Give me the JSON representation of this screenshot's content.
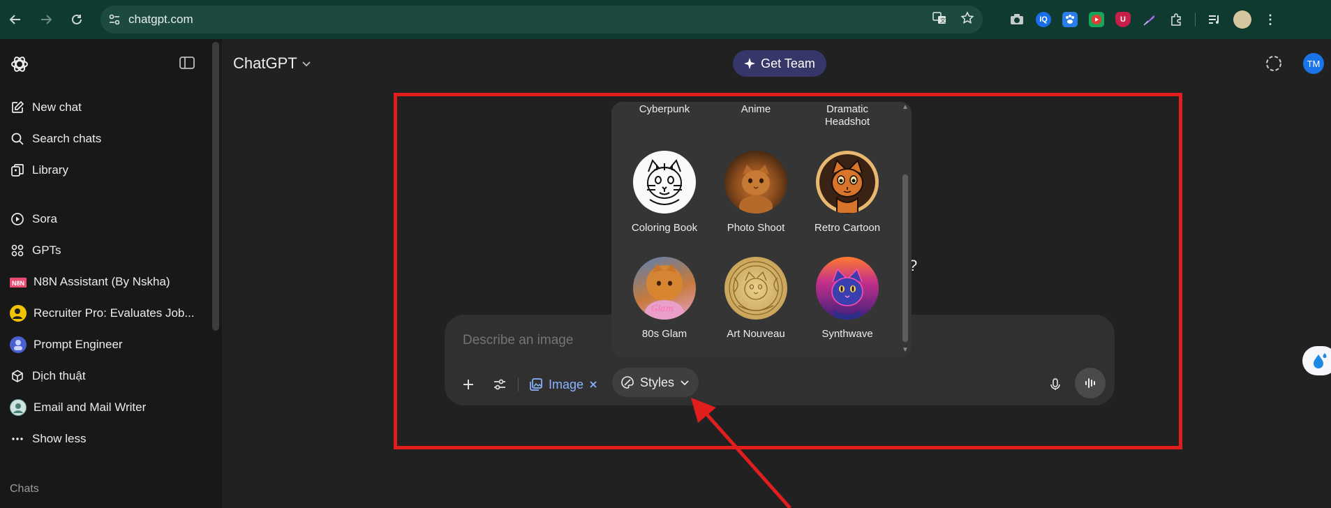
{
  "browser": {
    "url": "chatgpt.com",
    "back_icon": "arrow-left-icon",
    "forward_icon": "arrow-right-icon",
    "reload_icon": "reload-icon"
  },
  "sidebar": {
    "items": [
      {
        "label": "New chat",
        "icon": "compose-icon"
      },
      {
        "label": "Search chats",
        "icon": "search-icon"
      },
      {
        "label": "Library",
        "icon": "library-icon"
      },
      {
        "label": "Sora",
        "icon": "play-circle-icon"
      },
      {
        "label": "GPTs",
        "icon": "grid-icon"
      },
      {
        "label": "N8N Assistant (By Nskha)",
        "icon": "n8n-avatar"
      },
      {
        "label": "Recruiter Pro: Evaluates Job...",
        "icon": "recruiter-avatar"
      },
      {
        "label": "Prompt Engineer",
        "icon": "prompt-engineer-avatar"
      },
      {
        "label": "Dịch thuật",
        "icon": "cube-icon"
      },
      {
        "label": "Email and Mail Writer",
        "icon": "email-writer-avatar"
      },
      {
        "label": "Show less",
        "icon": "more-horizontal-icon"
      }
    ],
    "section_label": "Chats"
  },
  "header": {
    "model_name": "ChatGPT",
    "get_team_label": "Get Team",
    "user_initials": "TM"
  },
  "composer": {
    "placeholder": "Describe an image",
    "image_chip_label": "Image",
    "styles_label": "Styles"
  },
  "styles_popover": {
    "top_row": [
      "Cyberpunk",
      "Anime",
      "Dramatic Headshot"
    ],
    "tiles": [
      {
        "label": "Coloring Book"
      },
      {
        "label": "Photo Shoot"
      },
      {
        "label": "Retro Cartoon"
      },
      {
        "label": "80s Glam"
      },
      {
        "label": "Art Nouveau"
      },
      {
        "label": "Synthwave"
      }
    ]
  },
  "colors": {
    "annotation": "#e11d1d",
    "accent_link": "#8ab4ff",
    "team_button": "#373669"
  }
}
